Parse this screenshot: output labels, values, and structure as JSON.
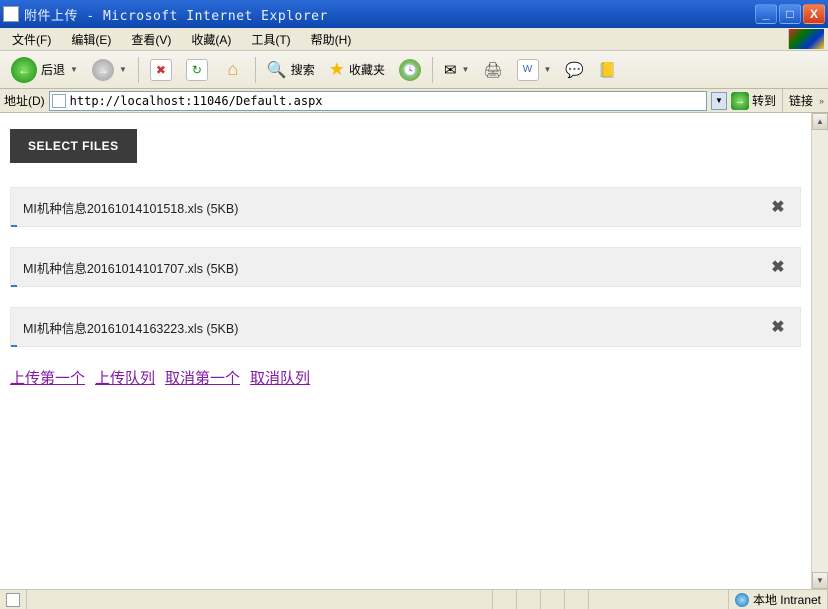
{
  "window": {
    "title": "附件上传 - Microsoft Internet Explorer"
  },
  "menu": {
    "items": [
      "文件(F)",
      "编辑(E)",
      "查看(V)",
      "收藏(A)",
      "工具(T)",
      "帮助(H)"
    ]
  },
  "toolbar": {
    "back": "后退",
    "search": "搜索",
    "favorites": "收藏夹"
  },
  "address": {
    "label": "地址(D)",
    "url": "http://localhost:11046/Default.aspx",
    "go": "转到",
    "links": "链接"
  },
  "page": {
    "select_label": "SELECT FILES",
    "files": [
      {
        "name": "MI机种信息20161014101518.xls (5KB)"
      },
      {
        "name": "MI机种信息20161014101707.xls (5KB)"
      },
      {
        "name": "MI机种信息20161014163223.xls (5KB)"
      }
    ],
    "actions": [
      "上传第一个",
      "上传队列",
      "取消第一个",
      "取消队列"
    ]
  },
  "status": {
    "zone": "本地 Intranet"
  }
}
